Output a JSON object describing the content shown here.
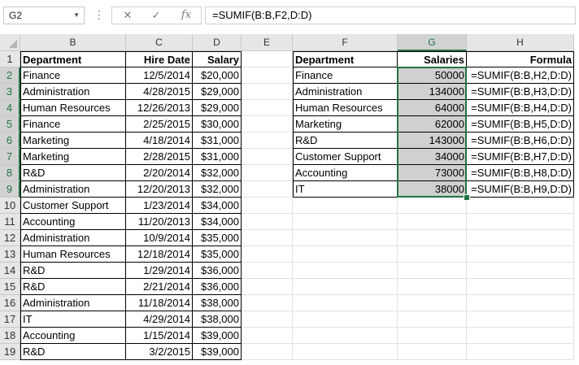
{
  "formula_bar": {
    "name_box": "G2",
    "cancel_icon": "✕",
    "enter_icon": "✓",
    "function_icon": "fx",
    "formula": "=SUMIF(B:B,F2,D:D)"
  },
  "columns": [
    "B",
    "C",
    "D",
    "E",
    "F",
    "G",
    "H"
  ],
  "rows": [
    "1",
    "2",
    "3",
    "4",
    "5",
    "6",
    "7",
    "8",
    "9",
    "10",
    "11",
    "12",
    "13",
    "14",
    "15",
    "16",
    "17",
    "18",
    "19"
  ],
  "selected": {
    "column": "G",
    "rows": [
      "2",
      "3",
      "4",
      "5",
      "6",
      "7",
      "8",
      "9"
    ]
  },
  "table1": {
    "headers": [
      "Department",
      "Hire Date",
      "Salary"
    ],
    "rows": [
      [
        "Finance",
        "12/5/2014",
        "$20,000"
      ],
      [
        "Administration",
        "4/28/2015",
        "$29,000"
      ],
      [
        "Human Resources",
        "12/26/2013",
        "$29,000"
      ],
      [
        "Finance",
        "2/25/2015",
        "$30,000"
      ],
      [
        "Marketing",
        "4/18/2014",
        "$31,000"
      ],
      [
        "Marketing",
        "2/28/2015",
        "$31,000"
      ],
      [
        "R&D",
        "2/20/2014",
        "$32,000"
      ],
      [
        "Administration",
        "12/20/2013",
        "$32,000"
      ],
      [
        "Customer Support",
        "1/23/2014",
        "$34,000"
      ],
      [
        "Accounting",
        "11/20/2013",
        "$34,000"
      ],
      [
        "Administration",
        "10/9/2014",
        "$35,000"
      ],
      [
        "Human Resources",
        "12/18/2014",
        "$35,000"
      ],
      [
        "R&D",
        "1/29/2014",
        "$36,000"
      ],
      [
        "R&D",
        "2/21/2014",
        "$36,000"
      ],
      [
        "Administration",
        "11/18/2014",
        "$38,000"
      ],
      [
        "IT",
        "4/29/2014",
        "$38,000"
      ],
      [
        "Accounting",
        "1/15/2014",
        "$39,000"
      ],
      [
        "R&D",
        "3/2/2015",
        "$39,000"
      ]
    ]
  },
  "table2": {
    "headers": [
      "Department",
      "Salaries",
      "Formula"
    ],
    "rows": [
      [
        "Finance",
        "50000",
        "=SUMIF(B:B,H2,D:D)"
      ],
      [
        "Administration",
        "134000",
        "=SUMIF(B:B,H3,D:D)"
      ],
      [
        "Human Resources",
        "64000",
        "=SUMIF(B:B,H4,D:D)"
      ],
      [
        "Marketing",
        "62000",
        "=SUMIF(B:B,H5,D:D)"
      ],
      [
        "R&D",
        "143000",
        "=SUMIF(B:B,H6,D:D)"
      ],
      [
        "Customer Support",
        "34000",
        "=SUMIF(B:B,H7,D:D)"
      ],
      [
        "Accounting",
        "73000",
        "=SUMIF(B:B,H8,D:D)"
      ],
      [
        "IT",
        "38000",
        "=SUMIF(B:B,H9,D:D)"
      ]
    ]
  },
  "colors": {
    "selection": "#217346",
    "shade": "#d0d0d0",
    "header_bg": "#e6e6e6"
  }
}
